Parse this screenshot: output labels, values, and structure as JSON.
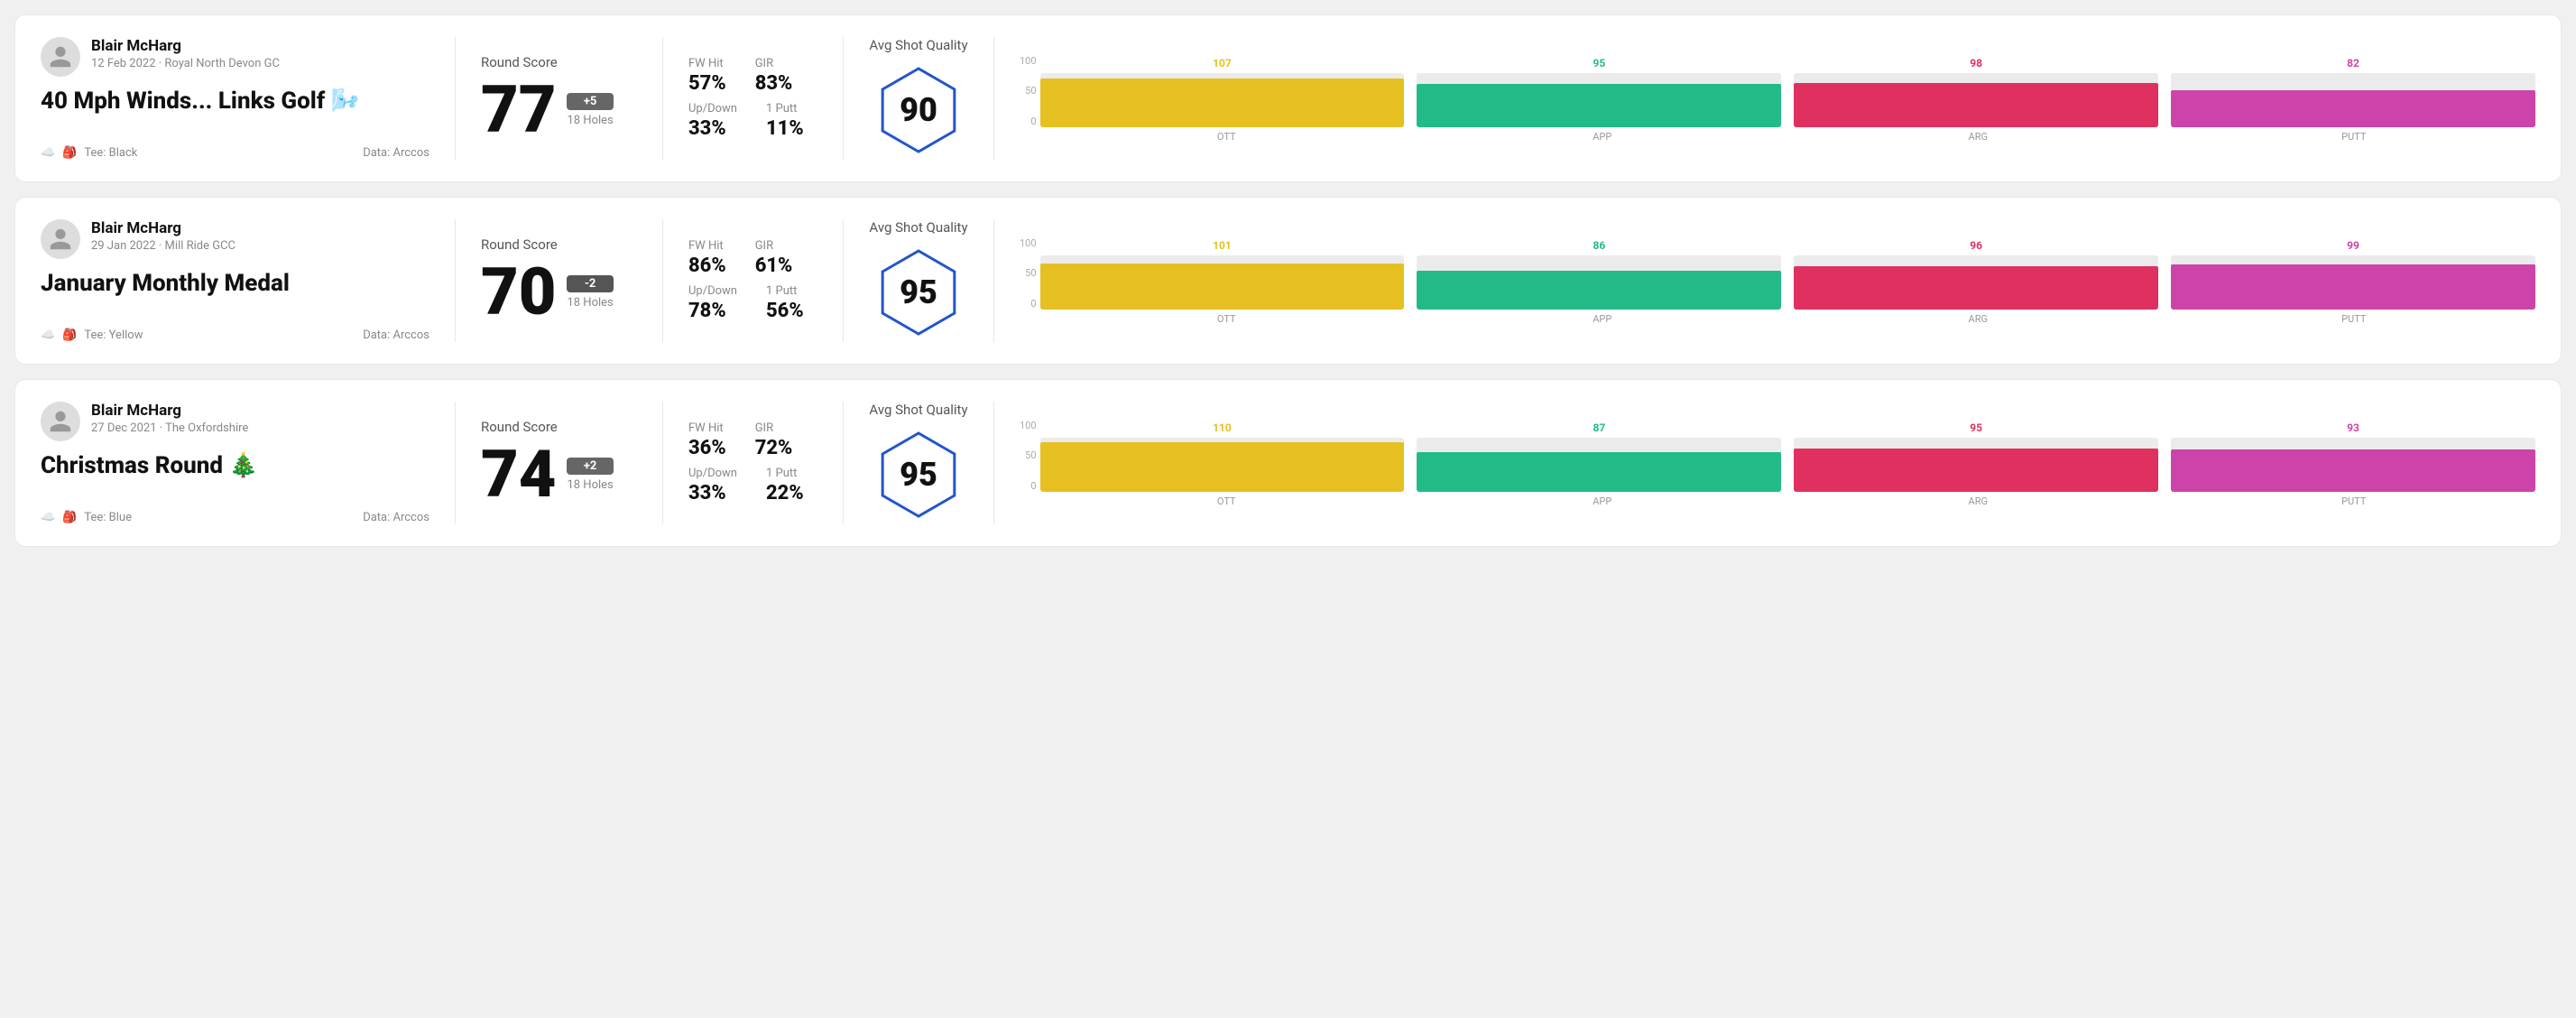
{
  "rounds": [
    {
      "id": "round1",
      "player": "Blair McHarg",
      "date": "12 Feb 2022",
      "course": "Royal North Devon GC",
      "title": "40 Mph Winds... Links Golf 🌬️",
      "tee": "Black",
      "data_source": "Arccos",
      "score": "77",
      "score_diff": "+5",
      "score_diff_type": "positive",
      "holes": "18 Holes",
      "fw_hit": "57%",
      "gir": "83%",
      "up_down": "33%",
      "one_putt": "11%",
      "avg_quality": "90",
      "bars": [
        {
          "label": "OTT",
          "value": 107,
          "color": "#e6c020"
        },
        {
          "label": "APP",
          "value": 95,
          "color": "#22bb88"
        },
        {
          "label": "ARG",
          "value": 98,
          "color": "#e03060"
        },
        {
          "label": "PUTT",
          "value": 82,
          "color": "#cc44aa"
        }
      ]
    },
    {
      "id": "round2",
      "player": "Blair McHarg",
      "date": "29 Jan 2022",
      "course": "Mill Ride GCC",
      "title": "January Monthly Medal",
      "tee": "Yellow",
      "data_source": "Arccos",
      "score": "70",
      "score_diff": "-2",
      "score_diff_type": "negative",
      "holes": "18 Holes",
      "fw_hit": "86%",
      "gir": "61%",
      "up_down": "78%",
      "one_putt": "56%",
      "avg_quality": "95",
      "bars": [
        {
          "label": "OTT",
          "value": 101,
          "color": "#e6c020"
        },
        {
          "label": "APP",
          "value": 86,
          "color": "#22bb88"
        },
        {
          "label": "ARG",
          "value": 96,
          "color": "#e03060"
        },
        {
          "label": "PUTT",
          "value": 99,
          "color": "#cc44aa"
        }
      ]
    },
    {
      "id": "round3",
      "player": "Blair McHarg",
      "date": "27 Dec 2021",
      "course": "The Oxfordshire",
      "title": "Christmas Round 🎄",
      "tee": "Blue",
      "data_source": "Arccos",
      "score": "74",
      "score_diff": "+2",
      "score_diff_type": "positive",
      "holes": "18 Holes",
      "fw_hit": "36%",
      "gir": "72%",
      "up_down": "33%",
      "one_putt": "22%",
      "avg_quality": "95",
      "bars": [
        {
          "label": "OTT",
          "value": 110,
          "color": "#e6c020"
        },
        {
          "label": "APP",
          "value": 87,
          "color": "#22bb88"
        },
        {
          "label": "ARG",
          "value": 95,
          "color": "#e03060"
        },
        {
          "label": "PUTT",
          "value": 93,
          "color": "#cc44aa"
        }
      ]
    }
  ],
  "labels": {
    "round_score": "Round Score",
    "fw_hit": "FW Hit",
    "gir": "GIR",
    "up_down": "Up/Down",
    "one_putt": "1 Putt",
    "avg_shot_quality": "Avg Shot Quality",
    "data": "Data:",
    "tee": "Tee:",
    "y_axis": [
      "100",
      "50",
      "0"
    ]
  }
}
